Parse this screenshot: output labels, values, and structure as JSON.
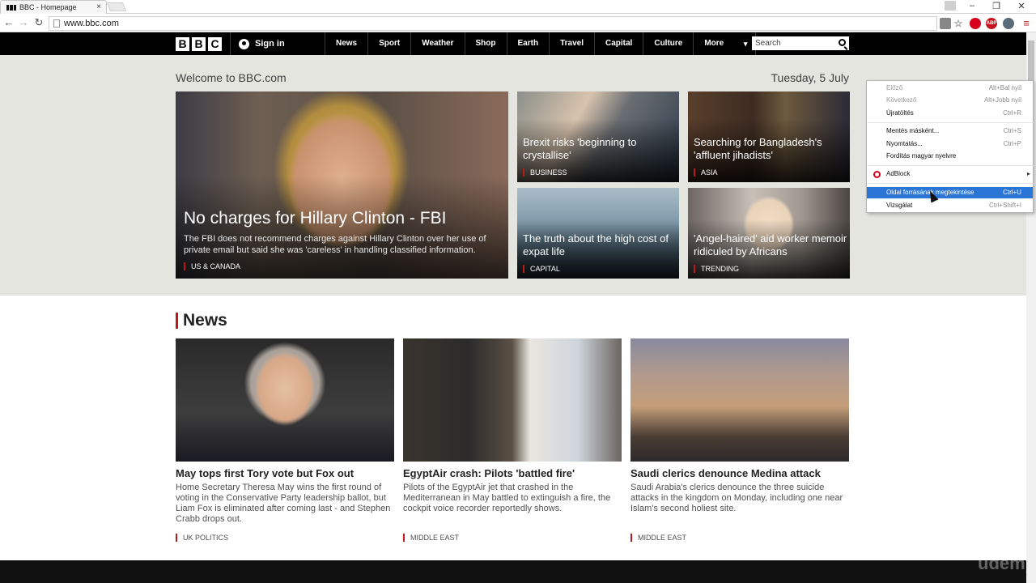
{
  "browser": {
    "tab_title": "BBC - Homepage",
    "tab_close": "×",
    "url": "www.bbc.com",
    "nav_back": "←",
    "nav_forward": "→",
    "nav_reload": "↻",
    "window_minimize": "–",
    "window_restore": "❐",
    "window_close": "✕",
    "extension_adblock_label": "ABP"
  },
  "bbc_nav": {
    "logo_letters": [
      "B",
      "B",
      "C"
    ],
    "signin": "Sign in",
    "links": [
      "News",
      "Sport",
      "Weather",
      "Shop",
      "Earth",
      "Travel",
      "Capital",
      "Culture"
    ],
    "more": "More",
    "search_placeholder": "Search"
  },
  "welcome": {
    "title": "Welcome to BBC.com",
    "date": "Tuesday, 5 July"
  },
  "hero": {
    "title": "No charges for Hillary Clinton - FBI",
    "summary": "The FBI does not recommend charges against Hillary Clinton over her use of private email but said she was 'careless' in handling classified information.",
    "tag": "US & CANADA"
  },
  "tiles": [
    {
      "title": "Brexit risks 'beginning to crystallise'",
      "tag": "BUSINESS"
    },
    {
      "title": "Searching for Bangladesh's 'affluent jihadists'",
      "tag": "ASIA"
    },
    {
      "title": "The truth about the high cost of expat life",
      "tag": "CAPITAL"
    },
    {
      "title": "'Angel-haired' aid worker memoir ridiculed by Africans",
      "tag": "TRENDING"
    }
  ],
  "news": {
    "section_title": "News",
    "cards": [
      {
        "title": "May tops first Tory vote but Fox out",
        "summary": "Home Secretary Theresa May wins the first round of voting in the Conservative Party leadership ballot, but Liam Fox is eliminated after coming last - and Stephen Crabb drops out.",
        "tag": "UK POLITICS"
      },
      {
        "title": "EgyptAir crash: Pilots 'battled fire'",
        "summary": "Pilots of the EgyptAir jet that crashed in the Mediterranean in May battled to extinguish a fire, the cockpit voice recorder reportedly shows.",
        "tag": "MIDDLE EAST"
      },
      {
        "title": "Saudi clerics denounce Medina attack",
        "summary": "Saudi Arabia's clerics denounce the three suicide attacks in the kingdom on Monday, including one near Islam's second holiest site.",
        "tag": "MIDDLE EAST"
      }
    ]
  },
  "context_menu": {
    "items": [
      {
        "label": "Előző",
        "shortcut": "Alt+Bal nyíl"
      },
      {
        "label": "Következő",
        "shortcut": "Alt+Jobb nyíl"
      },
      {
        "label": "Újratöltés",
        "shortcut": "Ctrl+R"
      },
      {
        "label": "Mentés másként...",
        "shortcut": "Ctrl+S"
      },
      {
        "label": "Nyomtatás...",
        "shortcut": "Ctrl+P"
      },
      {
        "label": "Fordítás magyar nyelvre",
        "shortcut": ""
      },
      {
        "label": "AdBlock",
        "shortcut": ""
      },
      {
        "label": "Oldal forrásának megtekintése",
        "shortcut": "Ctrl+U"
      },
      {
        "label": "Vizsgálat",
        "shortcut": "Ctrl+Shift+I"
      }
    ],
    "submenu_arrow": "▸"
  },
  "watermark": "udemy",
  "colors": {
    "bbc_red": "#bb1919",
    "menu_highlight": "#2b75d6",
    "nav_black": "#000000"
  }
}
